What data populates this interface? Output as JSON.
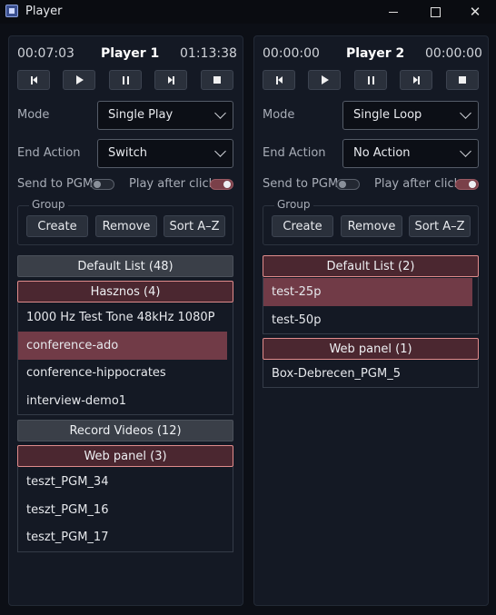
{
  "window": {
    "title": "Player",
    "icon": "app-icon"
  },
  "labels": {
    "mode": "Mode",
    "end_action": "End Action",
    "send_to_pgm": "Send to PGM",
    "play_after_click": "Play after click",
    "group": "Group",
    "create": "Create",
    "remove": "Remove",
    "sort": "Sort A–Z"
  },
  "players": [
    {
      "name": "Player 1",
      "elapsed": "00:07:03",
      "duration": "01:13:38",
      "mode": "Single Play",
      "end_action": "Switch",
      "send_to_pgm": false,
      "play_after_click": true,
      "lists": [
        {
          "title": "Default List (48)",
          "active": false,
          "items": []
        },
        {
          "title": "Hasznos (4)",
          "active": true,
          "items": [
            {
              "label": "1000 Hz Test Tone 48kHz 1080P",
              "selected": false
            },
            {
              "label": "conference-ado",
              "selected": true
            },
            {
              "label": "conference-hippocrates",
              "selected": false
            },
            {
              "label": "interview-demo1",
              "selected": false
            }
          ]
        },
        {
          "title": "Record Videos (12)",
          "active": false,
          "items": []
        },
        {
          "title": "Web panel (3)",
          "active": true,
          "items": [
            {
              "label": "teszt_PGM_34",
              "selected": false
            },
            {
              "label": "teszt_PGM_16",
              "selected": false
            },
            {
              "label": "teszt_PGM_17",
              "selected": false
            }
          ]
        }
      ]
    },
    {
      "name": "Player 2",
      "elapsed": "00:00:00",
      "duration": "00:00:00",
      "mode": "Single Loop",
      "end_action": "No Action",
      "send_to_pgm": false,
      "play_after_click": true,
      "lists": [
        {
          "title": "Default List (2)",
          "active": true,
          "items": [
            {
              "label": "test-25p",
              "selected": true
            },
            {
              "label": "test-50p",
              "selected": false
            }
          ]
        },
        {
          "title": "Web panel (1)",
          "active": true,
          "items": [
            {
              "label": "Box-Debrecen_PGM_5",
              "selected": false
            }
          ]
        }
      ]
    }
  ],
  "colors": {
    "accent_selected": "#713b47",
    "accent_border": "#e08c8c",
    "panel_bg": "#141924"
  }
}
